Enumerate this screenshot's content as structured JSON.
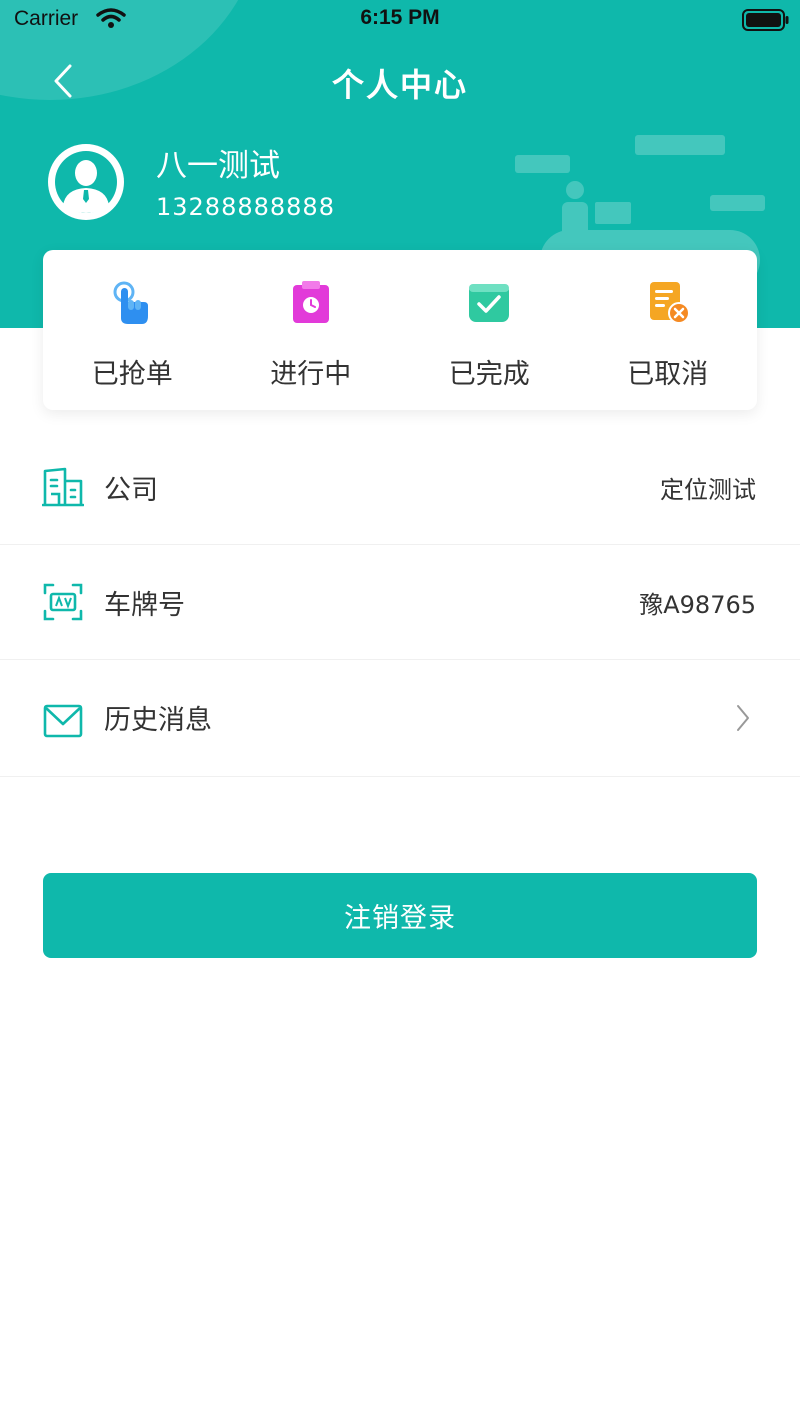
{
  "status_bar": {
    "carrier": "Carrier",
    "time": "6:15 PM"
  },
  "header": {
    "title": "个人中心"
  },
  "profile": {
    "name": "八一测试",
    "phone": "13288888888"
  },
  "stats": [
    {
      "label": "已抢单",
      "icon": "hand-tap-icon",
      "color": "#2e8ff0"
    },
    {
      "label": "进行中",
      "icon": "clipboard-clock-icon",
      "color": "#e23ad9"
    },
    {
      "label": "已完成",
      "icon": "check-box-icon",
      "color": "#2fc9a0"
    },
    {
      "label": "已取消",
      "icon": "document-cancel-icon",
      "color": "#f5a623"
    }
  ],
  "info": {
    "company": {
      "label": "公司",
      "value": "定位测试"
    },
    "plate": {
      "label": "车牌号",
      "value": "豫A98765"
    },
    "messages": {
      "label": "历史消息"
    }
  },
  "logout": {
    "label": "注销登录"
  },
  "colors": {
    "primary": "#0fb8ab",
    "text": "#333333"
  }
}
